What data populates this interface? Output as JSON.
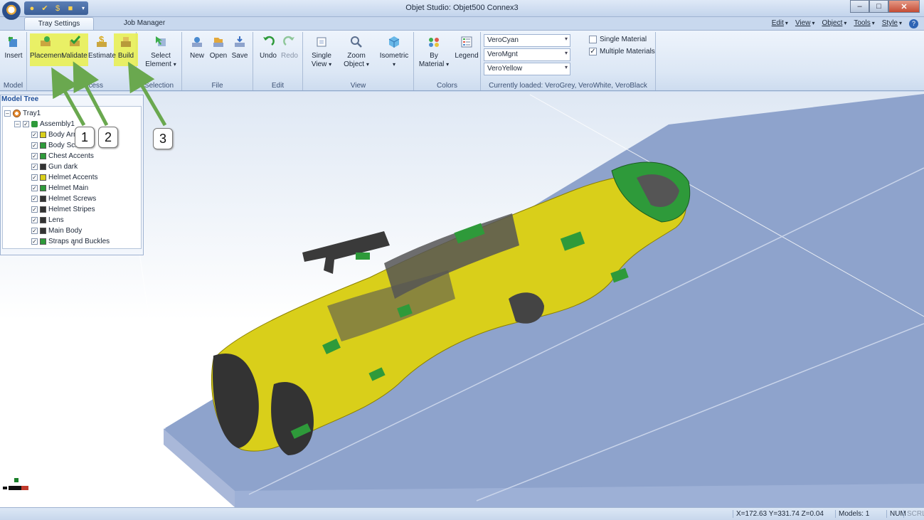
{
  "window": {
    "title": "Objet Studio: Objet500 Connex3",
    "minimize": "–",
    "maximize": "□",
    "close": "✕"
  },
  "tabs": [
    {
      "label": "Tray Settings",
      "active": true
    },
    {
      "label": "Job Manager",
      "active": false
    }
  ],
  "menus": {
    "edit": "Edit",
    "view": "View",
    "object": "Object",
    "tools": "Tools",
    "style": "Style"
  },
  "ribbon": {
    "model": {
      "label": "Model",
      "insert": "Insert"
    },
    "build_process": {
      "label": "Build Process",
      "placement": "Placement",
      "validate": "Validate",
      "estimate": "Estimate",
      "build": "Build"
    },
    "selection": {
      "label": "Selection",
      "select_element_1": "Select",
      "select_element_2": "Element"
    },
    "file": {
      "label": "File",
      "new": "New",
      "open": "Open",
      "save": "Save"
    },
    "edit": {
      "label": "Edit",
      "undo": "Undo",
      "redo": "Redo"
    },
    "view": {
      "label": "View",
      "single_view_1": "Single",
      "single_view_2": "View",
      "zoom_object_1": "Zoom",
      "zoom_object_2": "Object",
      "isometric": "Isometric"
    },
    "colors": {
      "label": "Colors",
      "by_material_1": "By",
      "by_material_2": "Material",
      "legend": "Legend"
    },
    "materials": {
      "combos": [
        "VeroCyan",
        "VeroMgnt",
        "VeroYellow"
      ],
      "single_material": "Single Material",
      "multiple_materials": "Multiple Materials",
      "single_checked": false,
      "multiple_checked": true,
      "currently_loaded": "Currently loaded: VeroGrey, VeroWhite, VeroBlack"
    }
  },
  "model_tree": {
    "title": "Model Tree",
    "tray": "Tray1",
    "assembly": "Assembly1",
    "parts": [
      {
        "name": "Body Armor",
        "color": "#d9cf1a"
      },
      {
        "name": "Body Screws",
        "color": "#2e9a3a"
      },
      {
        "name": "Chest Accents",
        "color": "#2e9a3a"
      },
      {
        "name": "Gun dark",
        "color": "#333333"
      },
      {
        "name": "Helmet Accents",
        "color": "#d9cf1a"
      },
      {
        "name": "Helmet Main",
        "color": "#2e9a3a"
      },
      {
        "name": "Helmet Screws",
        "color": "#333333"
      },
      {
        "name": "Helmet Stripes",
        "color": "#333333"
      },
      {
        "name": "Lens",
        "color": "#333333"
      },
      {
        "name": "Main Body",
        "color": "#333333"
      },
      {
        "name": "Straps and Buckles",
        "color": "#2e9a3a"
      }
    ]
  },
  "callouts": [
    "1",
    "2",
    "3"
  ],
  "status": {
    "coords": "X=172.63 Y=331.74 Z=0.04",
    "models": "Models: 1",
    "num": "NUM",
    "scrl": "SCRL"
  },
  "colors": {
    "highlight": "#e9f04b",
    "armor_yellow": "#d9cf1a",
    "armor_green": "#2e9a3a",
    "tray_blue": "#8ea3cc",
    "arrow_green": "#6aa84f"
  }
}
